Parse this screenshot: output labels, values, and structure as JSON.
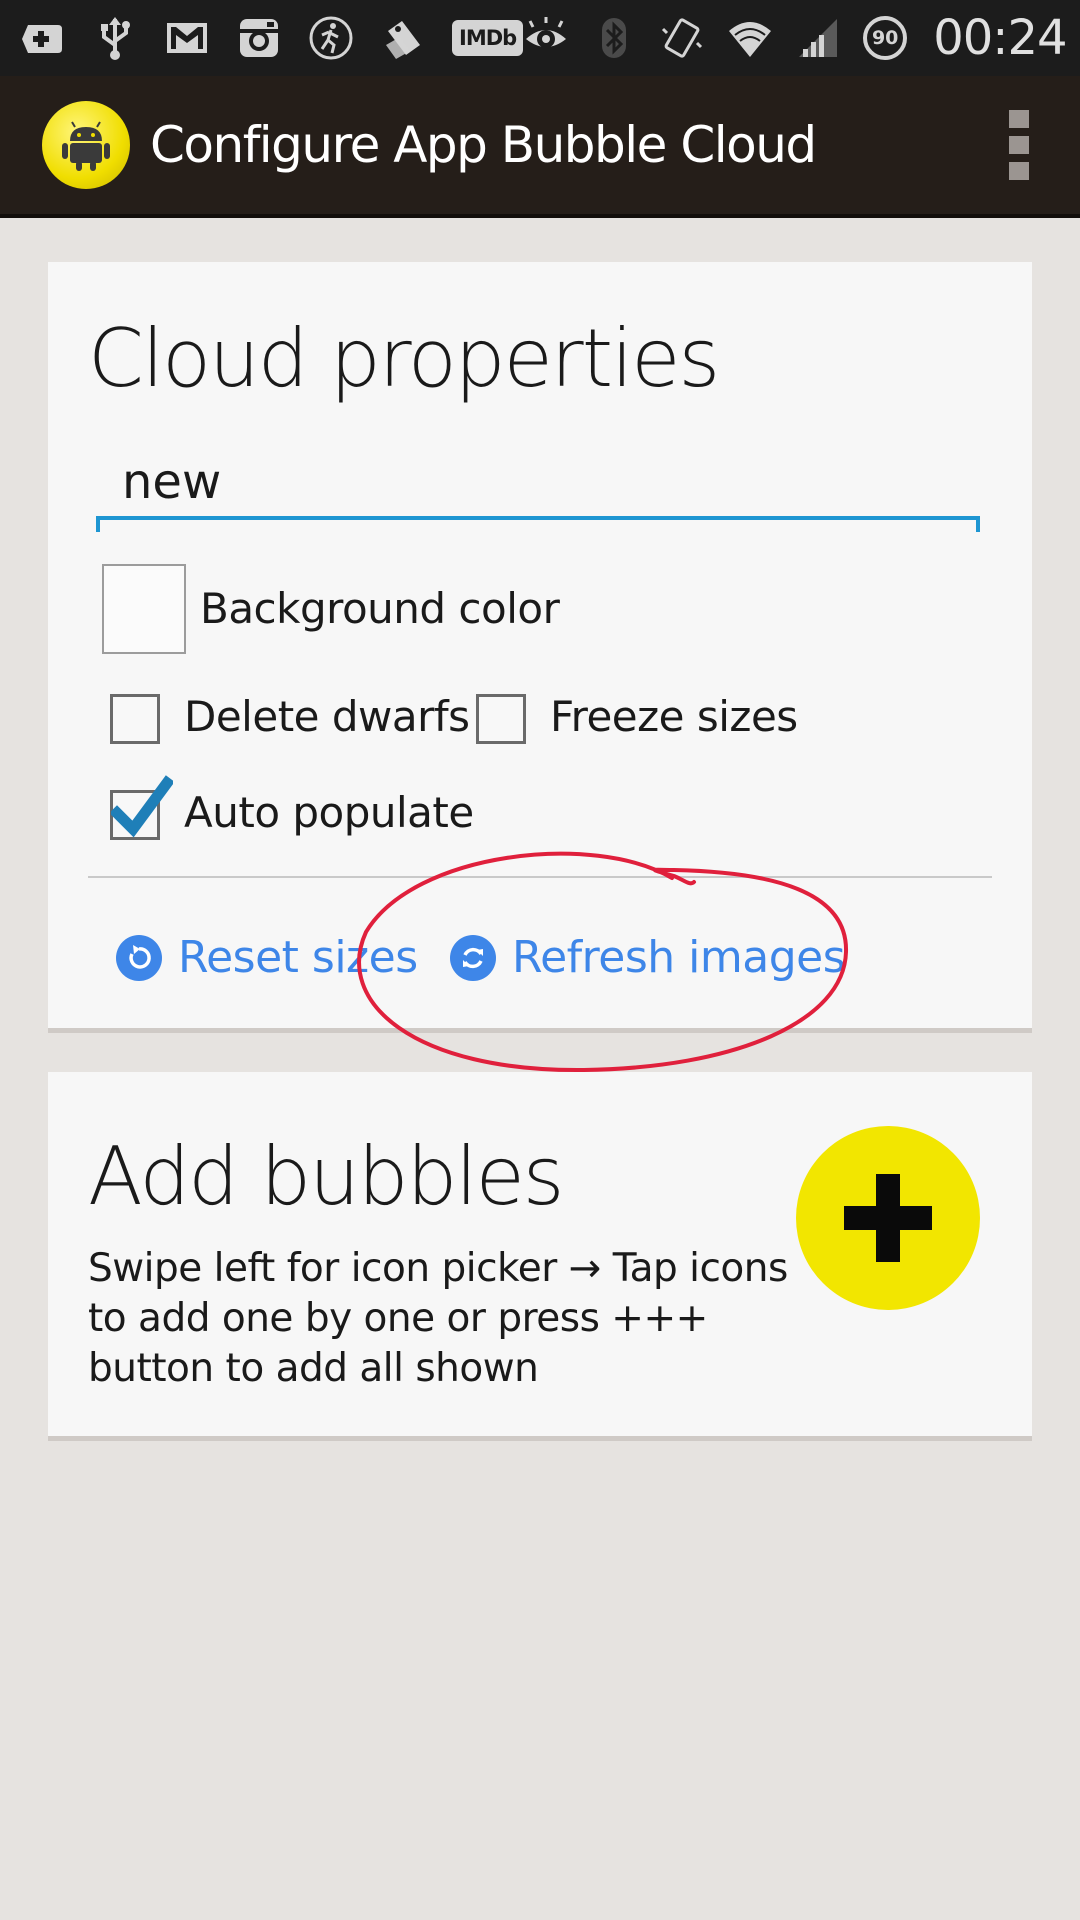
{
  "status_bar": {
    "icons": [
      "add-box-icon",
      "usb-icon",
      "gmail-icon",
      "instagram-icon",
      "runner-icon",
      "tag-icon",
      "imdb-icon",
      "eye-icon",
      "bluetooth-icon",
      "vibrate-icon",
      "wifi-icon",
      "signal-icon",
      "battery-icon"
    ],
    "imdb_label": "IMDb",
    "battery_level": "90",
    "time": "00:24"
  },
  "app_bar": {
    "title": "Configure App Bubble Cloud",
    "logo_icon": "android-icon",
    "menu_icon": "overflow-menu-icon"
  },
  "cloud_properties": {
    "title": "Cloud properties",
    "name_value": "new",
    "background_color_label": "Background color",
    "checkboxes": [
      {
        "label": "Delete dwarfs",
        "checked": false
      },
      {
        "label": "Freeze sizes",
        "checked": false
      },
      {
        "label": "Auto populate",
        "checked": true
      }
    ],
    "actions": [
      {
        "label": "Reset sizes",
        "icon": "reset-icon"
      },
      {
        "label": "Refresh images",
        "icon": "refresh-icon"
      }
    ]
  },
  "add_bubbles": {
    "title": "Add bubbles",
    "description": "Swipe left for icon picker → Tap icons to add one by one or press +++ button to add all shown",
    "button_icon": "plus-icon"
  },
  "colors": {
    "accent": "#3e86e8",
    "input_underline": "#1e96d2",
    "fab": "#f2e600",
    "app_bar": "#251e19",
    "annotation": "#e0203c"
  }
}
